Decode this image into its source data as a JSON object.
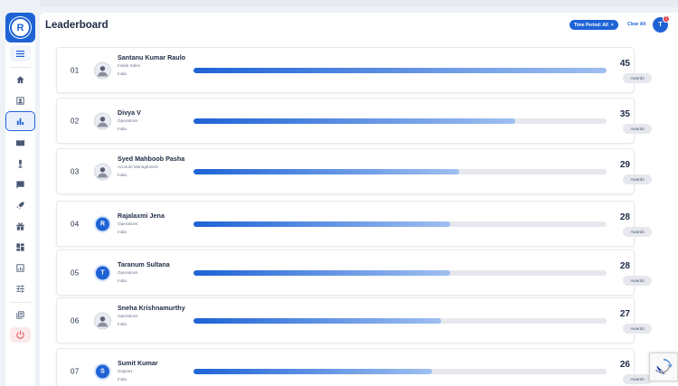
{
  "sidebar": {
    "logo_letter": "R",
    "items": [
      {
        "icon": "home-icon"
      },
      {
        "icon": "contact-card-icon"
      },
      {
        "icon": "bar-chart-icon",
        "active": true
      },
      {
        "icon": "book-icon"
      },
      {
        "icon": "trophy-icon"
      },
      {
        "icon": "feedback-icon"
      },
      {
        "icon": "rocket-icon"
      },
      {
        "icon": "gift-icon"
      },
      {
        "icon": "dashboard-icon"
      },
      {
        "icon": "analytics-icon"
      },
      {
        "icon": "tune-icon"
      },
      {
        "icon": "library-icon"
      },
      {
        "icon": "power-icon"
      }
    ]
  },
  "header": {
    "title": "Leaderboard",
    "filter_chip": "Time Period: All",
    "filter_close": "×",
    "clear_all": "Clear All",
    "user_initial": "T",
    "notification_count": "1"
  },
  "colors": {
    "accent": "#1e63d6",
    "danger": "#e23b44",
    "track": "#e6e8ed"
  },
  "leaderboard": [
    {
      "rank": "01",
      "name": "Santanu Kumar Raulo",
      "role": "Inside Sales",
      "country": "India",
      "score": "45",
      "progress": 1.0,
      "avatar": "photo",
      "awards_label": "Awards"
    },
    {
      "rank": "02",
      "name": "Divya V",
      "role": "Operations",
      "country": "India",
      "score": "35",
      "progress": 0.778,
      "avatar": "photo",
      "awards_label": "Awards"
    },
    {
      "rank": "03",
      "name": "Syed Mahboob Pasha",
      "role": "Account Management",
      "country": "India",
      "score": "29",
      "progress": 0.644,
      "avatar": "photo",
      "awards_label": "Awards"
    },
    {
      "rank": "04",
      "name": "Rajalaxmi Jena",
      "role": "Operations",
      "country": "India",
      "score": "28",
      "progress": 0.622,
      "avatar": "R",
      "awards_label": "Awards"
    },
    {
      "rank": "05",
      "name": "Taranum Sultana",
      "role": "Operations",
      "country": "India",
      "score": "28",
      "progress": 0.622,
      "avatar": "T",
      "awards_label": "Awards"
    },
    {
      "rank": "06",
      "name": "Sneha Krishnamurthy",
      "role": "Operations",
      "country": "India",
      "score": "27",
      "progress": 0.6,
      "avatar": "photo",
      "awards_label": "Awards"
    },
    {
      "rank": "07",
      "name": "Sumit Kumar",
      "role": "Support",
      "country": "India",
      "score": "26",
      "progress": 0.578,
      "avatar": "S",
      "awards_label": "Awards"
    }
  ]
}
